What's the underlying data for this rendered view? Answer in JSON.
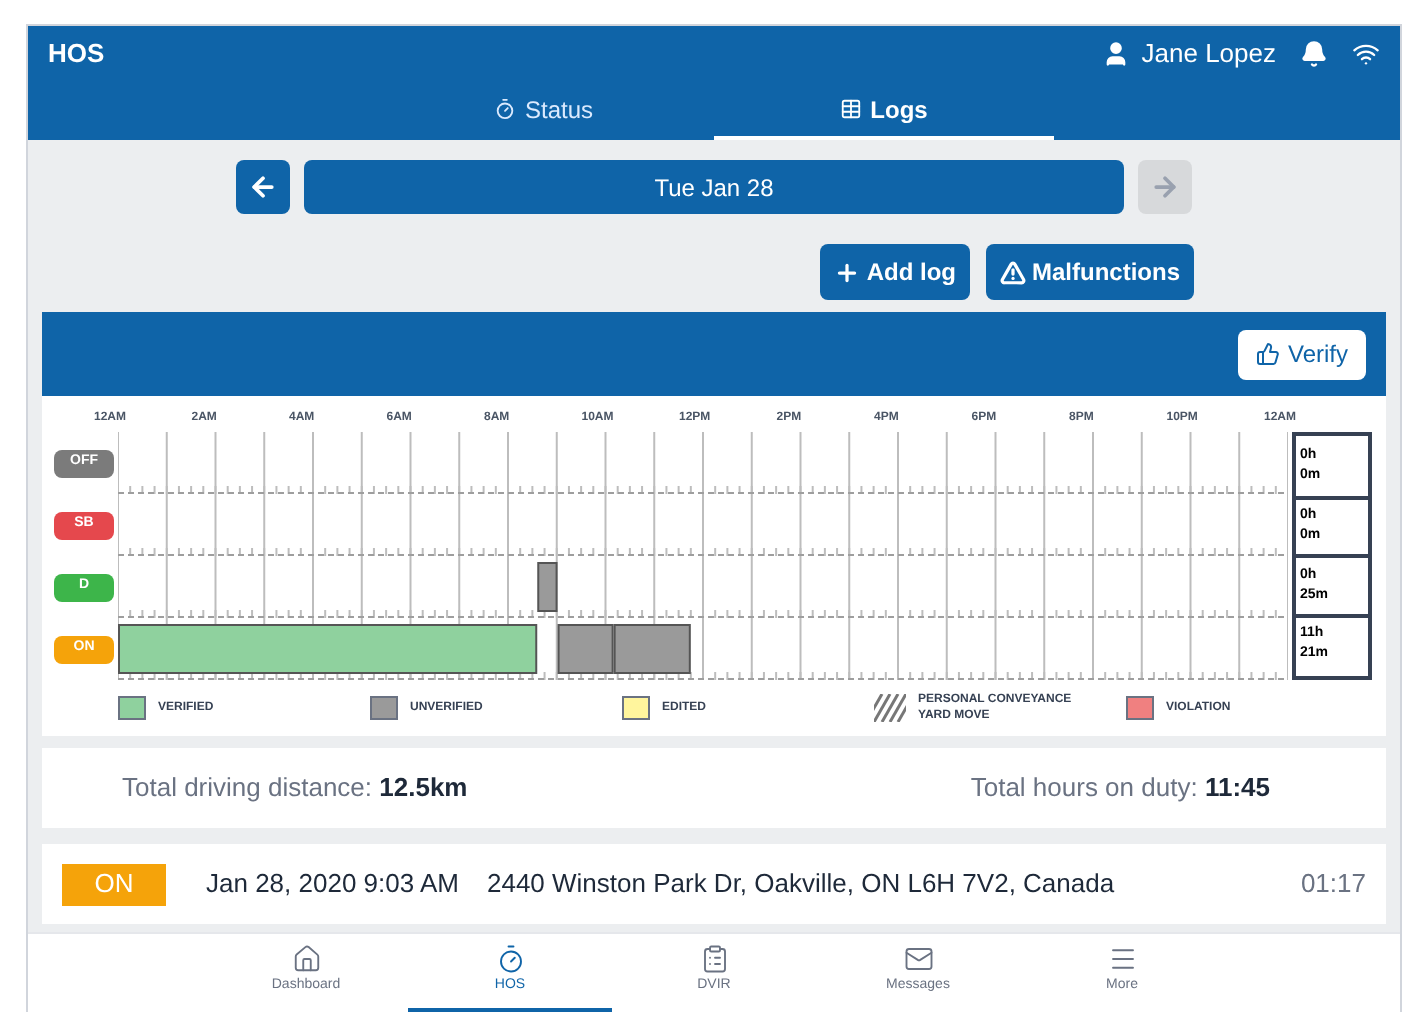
{
  "header": {
    "title": "HOS",
    "user": "Jane Lopez"
  },
  "tabs": [
    {
      "label": "Status",
      "selected": false
    },
    {
      "label": "Logs",
      "selected": true
    }
  ],
  "date_nav": {
    "date": "Tue Jan 28",
    "prev_disabled": false,
    "next_disabled": true
  },
  "actions": [
    {
      "label": "Add log"
    },
    {
      "label": "Malfunctions"
    }
  ],
  "card": {
    "verify_label": "Verify"
  },
  "log_grid": {
    "hour_labels": [
      "12AM",
      "2AM",
      "4AM",
      "6AM",
      "8AM",
      "10AM",
      "12PM",
      "2PM",
      "4PM",
      "6PM",
      "8PM",
      "10PM",
      "12AM"
    ],
    "rows": [
      {
        "label": "OFF",
        "color": "#7b7b7b",
        "total_h": "0h",
        "total_m": "0m"
      },
      {
        "label": "SB",
        "color": "#e5484d",
        "total_h": "0h",
        "total_m": "0m"
      },
      {
        "label": "D",
        "color": "#3db54a",
        "total_h": "0h",
        "total_m": "25m"
      },
      {
        "label": "ON",
        "color": "#f5a30a",
        "total_h": "11h",
        "total_m": "21m"
      }
    ],
    "legend": [
      {
        "kind": "verified",
        "lines": [
          "VERIFIED"
        ]
      },
      {
        "kind": "unverified",
        "lines": [
          "UNVERIFIED"
        ]
      },
      {
        "kind": "edited",
        "lines": [
          "EDITED"
        ]
      },
      {
        "kind": "personal",
        "lines": [
          "PERSONAL CONVEYANCE",
          "YARD MOVE"
        ]
      },
      {
        "kind": "violation",
        "lines": [
          "VIOLATION"
        ]
      }
    ]
  },
  "totals": {
    "distance_label": "Total driving distance:",
    "distance": "12.5km",
    "hours_label": "Total hours on duty:",
    "hours": "11:45"
  },
  "entries": [
    {
      "status": "ON",
      "color": "#f5a30a",
      "time": "Jan 28, 2020 9:03 AM",
      "address": "2440 Winston Park Dr, Oakville, ON L6H 7V2, Canada",
      "duration": "01:17"
    }
  ],
  "bottom_nav": [
    {
      "label": "Dashboard",
      "selected": false
    },
    {
      "label": "HOS",
      "selected": true
    },
    {
      "label": "DVIR",
      "selected": false
    },
    {
      "label": "Messages",
      "selected": false
    },
    {
      "label": "More",
      "selected": false
    }
  ]
}
